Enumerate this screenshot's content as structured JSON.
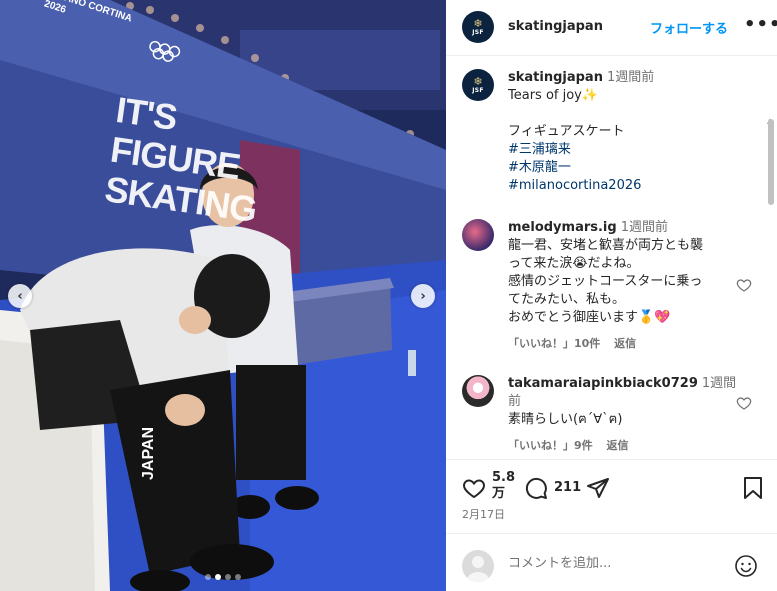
{
  "photo": {
    "banner_lines": [
      "IT'S",
      "FIGURE",
      "SKATING"
    ],
    "brand_text": "MILANO CORTINA",
    "brand_year": "2026",
    "jacket_text": "JAPAN",
    "carousel_dots": 4,
    "active_dot": 1
  },
  "header": {
    "avatar_text": "JSF",
    "username": "skatingjapan",
    "follow_label": "フォローする",
    "more_label": "•••"
  },
  "caption": {
    "username": "skatingjapan",
    "time": "1週間前",
    "first_line": "Tears of joy✨",
    "second_line": "フィギュアスケート",
    "hashtags": [
      "#三浦璃来",
      "#木原龍一",
      "#milanocortina2026"
    ]
  },
  "comments": [
    {
      "username": "melodymars.ig",
      "time": "1週間前",
      "lines": [
        "龍一君、安堵と歓喜が両方とも襲",
        "って来た涙😭だよね。",
        "感情のジェットコースターに乗っ",
        "てたみたい、私も。",
        "おめでとう御座います🥇💖"
      ],
      "likes_label": "「いいね！」10件",
      "reply_label": "返信"
    },
    {
      "username": "takamaraiapinkbiack0729",
      "time": "1週間前",
      "lines": [
        "素晴らしい(ฅ´∀`ฅ)"
      ],
      "likes_label": "「いいね！」9件",
      "reply_label": "返信"
    }
  ],
  "actions": {
    "likes_count_line1": "5.8",
    "likes_count_line2": "万",
    "comments_count": "211",
    "date": "2月17日"
  },
  "comment_box": {
    "placeholder": "コメントを追加..."
  },
  "colors": {
    "accent": "#0095f6",
    "hashtag": "#00376b",
    "muted": "#737373"
  }
}
